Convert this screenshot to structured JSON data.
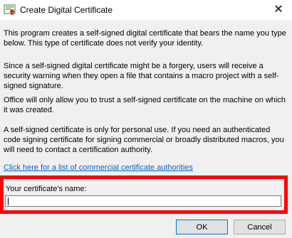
{
  "window": {
    "title": "Create Digital Certificate",
    "icon": "certificate-icon",
    "close_glyph": "✕"
  },
  "paragraphs": [
    "This program creates a self-signed digital certificate that bears the name you type below. This type of certificate does not verify your identity.",
    "Since a self-signed digital certificate might be a forgery, users will receive a security warning when they open a file that contains a macro project with a self-signed signature.",
    "Office will only allow you to trust a self-signed certificate on the machine on which it was created.",
    "A self-signed certificate is only for personal use. If you need an authenticated code signing certificate for signing commercial or broadly distributed macros, you will need to contact a certification authority."
  ],
  "link": {
    "text": "Click here for a list of commercial certificate authorities"
  },
  "name_field": {
    "label": "Your certificate's name:",
    "value": ""
  },
  "buttons": {
    "ok": "OK",
    "cancel": "Cancel"
  },
  "colors": {
    "highlight": "#ff0000",
    "link": "#0066cc",
    "dialog_bg": "#f0f0f0"
  }
}
